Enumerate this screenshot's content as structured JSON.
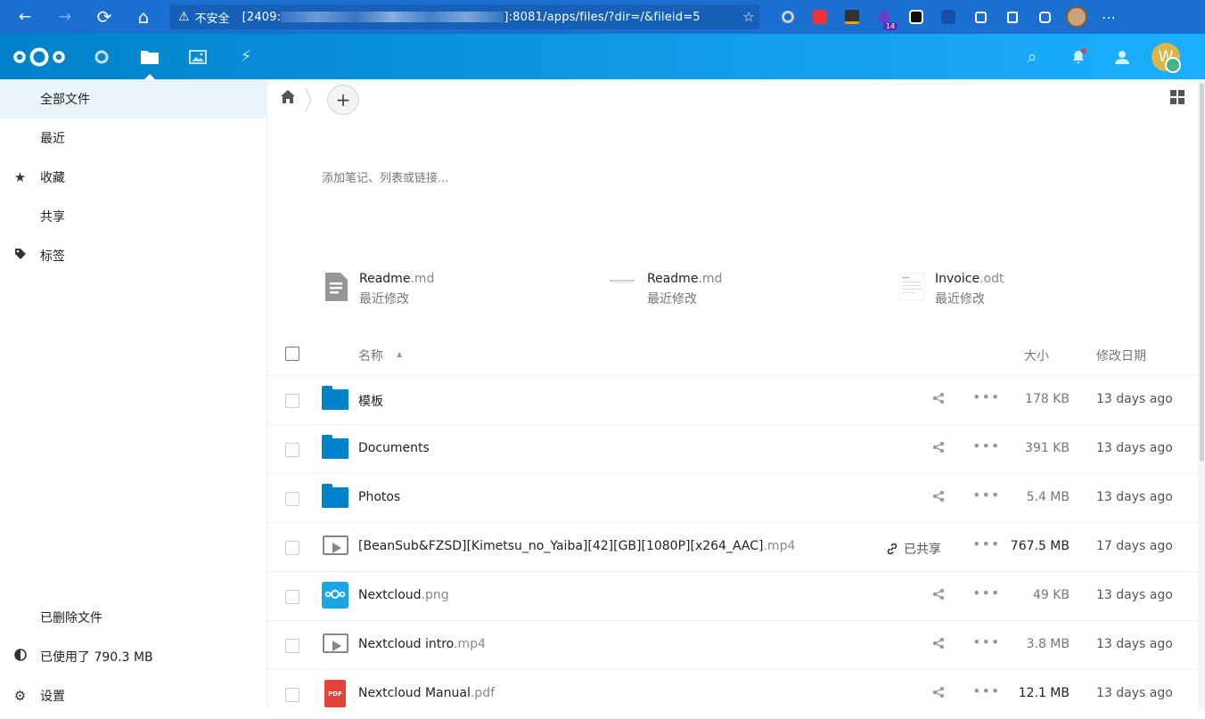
{
  "browser": {
    "back_icon": "←",
    "forward_icon": "→",
    "reload_icon": "⟳",
    "home_icon": "⌂",
    "warning_icon": "⚠",
    "insecure_label": "不安全",
    "url_prefix": "[2409:",
    "url_suffix": "]:8081/apps/files/?dir=/&fileid=5",
    "favorite_icon": "☆",
    "extension_badge": "14",
    "more_icon": "⋯"
  },
  "header": {
    "apps": [
      {
        "name": "dashboard",
        "icon": "○"
      },
      {
        "name": "files",
        "icon": "folder"
      },
      {
        "name": "photos",
        "icon": "image"
      },
      {
        "name": "activity",
        "icon": "⚡"
      }
    ],
    "search_icon": "⌕",
    "notification_icon": "bell",
    "contacts_icon": "contacts",
    "user_initial": "W"
  },
  "sidebar": {
    "items": [
      {
        "label": "全部文件",
        "icon": ""
      },
      {
        "label": "最近",
        "icon": ""
      },
      {
        "label": "收藏",
        "icon": "★"
      },
      {
        "label": "共享",
        "icon": ""
      },
      {
        "label": "标签",
        "icon": "tag"
      }
    ],
    "deleted_label": "已删除文件",
    "quota_label": "已使用了 790.3 MB",
    "settings_label": "设置",
    "settings_icon": "⚙"
  },
  "content": {
    "add_label": "+",
    "note_placeholder": "添加笔记、列表或链接...",
    "recent_files": [
      {
        "name": "Readme",
        "ext": ".md",
        "subtitle": "最近修改"
      },
      {
        "name": "Readme",
        "ext": ".md",
        "subtitle": "最近修改"
      },
      {
        "name": "Invoice",
        "ext": ".odt",
        "subtitle": "最近修改"
      }
    ],
    "columns": {
      "name": "名称",
      "size": "大小",
      "modified": "修改日期"
    },
    "files": [
      {
        "name": "模板",
        "ext": "",
        "type": "folder",
        "share": "",
        "size": "178 KB",
        "date": "13 days ago"
      },
      {
        "name": "Documents",
        "ext": "",
        "type": "folder",
        "share": "",
        "size": "391 KB",
        "date": "13 days ago"
      },
      {
        "name": "Photos",
        "ext": "",
        "type": "folder",
        "share": "",
        "size": "5.4 MB",
        "date": "13 days ago"
      },
      {
        "name": "[BeanSub&FZSD][Kimetsu_no_Yaiba][42][GB][1080P][x264_AAC]",
        "ext": ".mp4",
        "type": "video",
        "share": "已共享",
        "size": "767.5 MB",
        "date": "17 days ago"
      },
      {
        "name": "Nextcloud",
        "ext": ".png",
        "type": "image",
        "share": "",
        "size": "49 KB",
        "date": "13 days ago"
      },
      {
        "name": "Nextcloud intro",
        "ext": ".mp4",
        "type": "video",
        "share": "",
        "size": "3.8 MB",
        "date": "13 days ago"
      },
      {
        "name": "Nextcloud Manual",
        "ext": ".pdf",
        "type": "pdf",
        "share": "",
        "size": "12.1 MB",
        "date": "13 days ago"
      }
    ],
    "pdf_badge": "PDF"
  },
  "colors": {
    "header_start": "#0082c9",
    "header_end": "#1cafff",
    "folder": "#0082c9",
    "browser_bar": "#1b6fd1"
  }
}
